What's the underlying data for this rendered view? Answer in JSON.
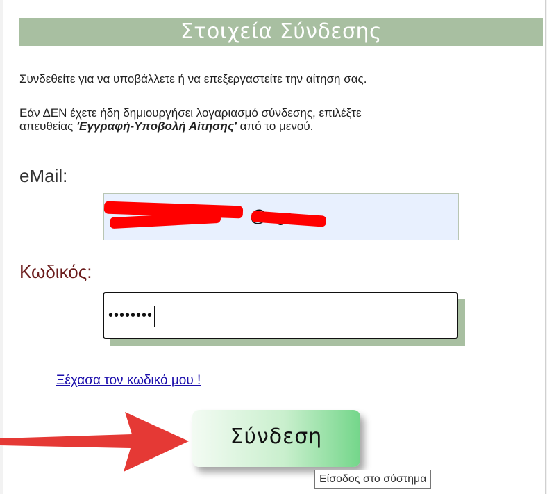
{
  "header": {
    "title": "Στοιχεία Σύνδεσης"
  },
  "intro_text": "Συνδεθείτε για να υποβάλλετε ή να επεξεργαστείτε την αίτηση σας.",
  "note": {
    "line1": "Εάν ΔΕΝ έχετε ήδη δημιουργήσει λογαριασμό σύνδεσης, επιλέξτε",
    "prefix": "απευθείας ",
    "bold": "'Εγγραφή-Υποβολή Αίτησης'",
    "suffix": " από το μενού."
  },
  "email": {
    "label": "eMail:",
    "value_suffix": "@ .gr"
  },
  "password": {
    "label": "Κωδικός:",
    "masked": "••••••••"
  },
  "forgot_link": "Ξέχασα τον κωδικό μου !",
  "login_button": "Σύνδεση",
  "tooltip": "Είσοδος στο σύστημα",
  "colors": {
    "header_bg": "#a8bfa1",
    "label_color": "#6b1c1c",
    "arrow": "#e53935"
  }
}
